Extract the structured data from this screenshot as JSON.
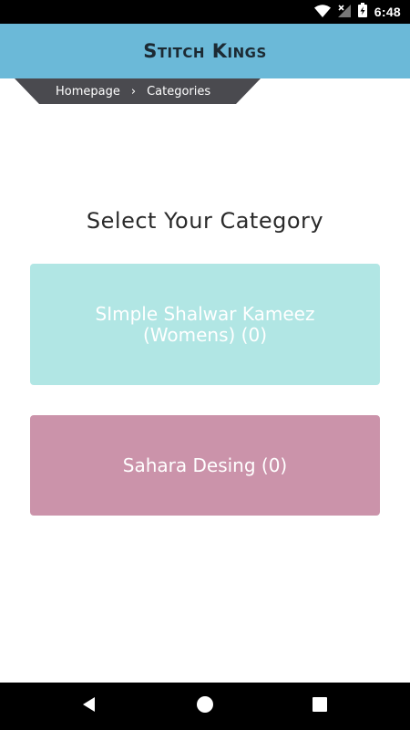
{
  "status_bar": {
    "time": "6:48",
    "icons": [
      "wifi-icon",
      "signal-no-service-icon",
      "battery-charging-icon"
    ]
  },
  "app_bar": {
    "title": "Stitch Kings",
    "background": "#6bb9d8"
  },
  "breadcrumb": {
    "items": [
      "Homepage",
      "Categories"
    ],
    "separator": "›",
    "background": "#4a4a4f"
  },
  "main": {
    "heading": "Select Your Category",
    "categories": [
      {
        "label": "SImple Shalwar Kameez (Womens) (0)",
        "color": "#b1e6e4"
      },
      {
        "label": "Sahara Desing (0)",
        "color": "#cb93aa"
      }
    ]
  },
  "nav_bar": {
    "buttons": [
      "back-icon",
      "home-icon",
      "recents-icon"
    ]
  }
}
